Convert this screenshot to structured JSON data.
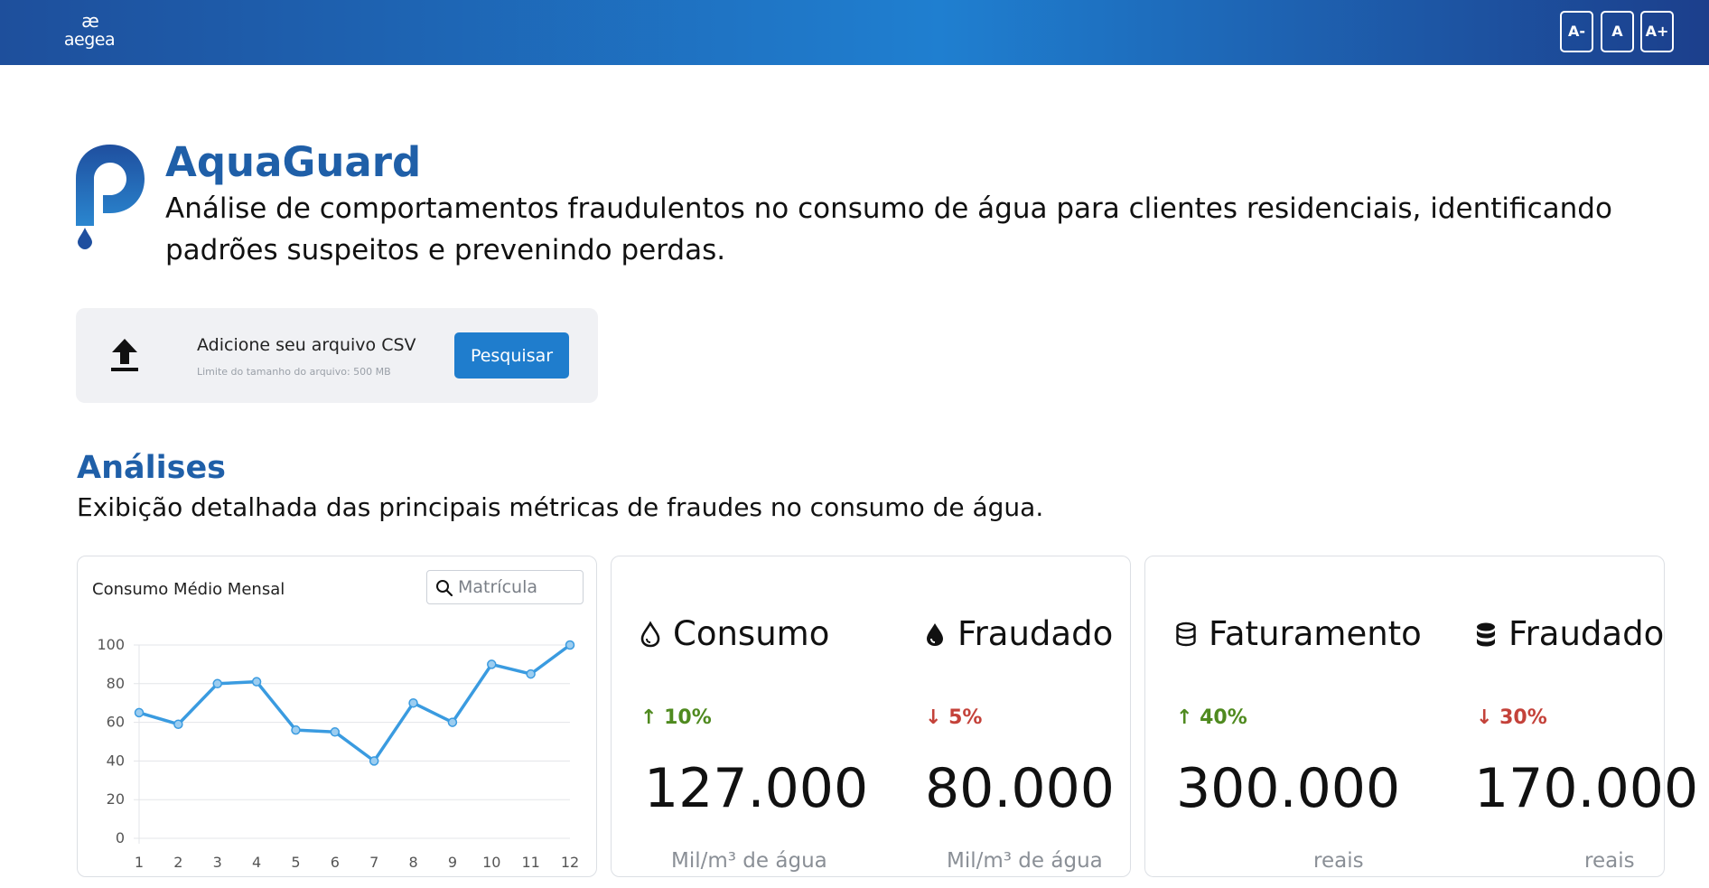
{
  "header": {
    "logo_mark": "æ",
    "logo_word": "aegea",
    "font_buttons": {
      "decrease": "A-",
      "normal": "A",
      "increase": "A+"
    }
  },
  "app": {
    "title": "AquaGuard",
    "description": "Análise de comportamentos fraudulentos no consumo de água para clientes residenciais, identificando padrões suspeitos e prevenindo perdas.",
    "icon": "aquaguard-logo-icon"
  },
  "upload": {
    "icon": "upload-icon",
    "title": "Adicione seu arquivo CSV",
    "limit": "Limite do tamanho do arquivo: 500 MB",
    "button": "Pesquisar"
  },
  "analises": {
    "title": "Análises",
    "description": "Exibição detalhada das principais métricas de fraudes no consumo de água."
  },
  "chart_card": {
    "title": "Consumo Médio Mensal",
    "search_placeholder": "Matrícula",
    "line_color": "#3a9be0"
  },
  "chart_data": {
    "type": "line",
    "title": "Consumo Médio Mensal",
    "x": [
      1,
      2,
      3,
      4,
      5,
      6,
      7,
      8,
      9,
      10,
      11,
      12
    ],
    "y": [
      65,
      59,
      80,
      81,
      56,
      55,
      40,
      70,
      60,
      90,
      85,
      100
    ],
    "ylim": [
      0,
      100
    ],
    "yticks": [
      0,
      20,
      40,
      60,
      80,
      100
    ],
    "grid": true,
    "xlabel": "",
    "ylabel": ""
  },
  "metrics": {
    "consumo": {
      "label": "Consumo",
      "icon": "water-drop-outline-icon",
      "trend": "↑ 10%",
      "value": "127.000",
      "unit": "Mil/m³ de água"
    },
    "consumo_fraudado": {
      "label": "Fraudado",
      "icon": "water-drop-filled-icon",
      "trend": "↓ 5%",
      "value": "80.000",
      "unit": "Mil/m³ de água"
    },
    "faturamento": {
      "label": "Faturamento",
      "icon": "database-outline-icon",
      "trend": "↑ 40%",
      "value": "300.000",
      "unit": "reais"
    },
    "faturamento_fraudado": {
      "label": "Fraudado",
      "icon": "database-filled-icon",
      "trend": "↓ 30%",
      "value": "170.000",
      "unit": "reais"
    }
  },
  "colors": {
    "brand": "#1f5fa8",
    "button": "#1f7dcd",
    "trend_up": "#4f8a1f",
    "trend_down": "#c4423a"
  }
}
